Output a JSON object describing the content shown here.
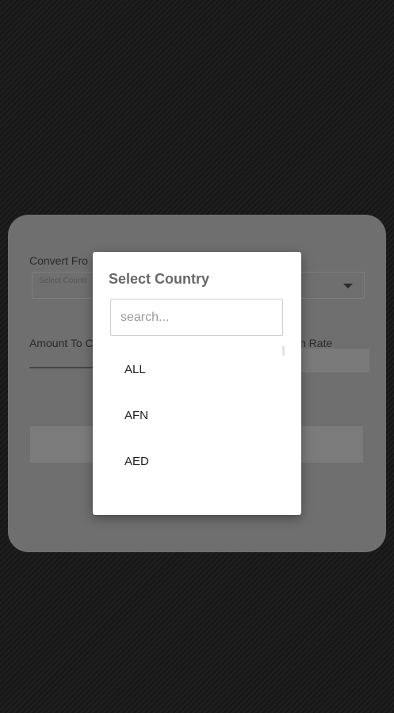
{
  "converter": {
    "convert_from_label": "Convert Fro",
    "select_placeholder": "Select Countr",
    "amount_label": "Amount To C",
    "rate_label": "n Rate"
  },
  "dialog": {
    "title": "Select Country",
    "search_placeholder": "search...",
    "items": [
      {
        "label": "ALL"
      },
      {
        "label": "AFN"
      },
      {
        "label": "AED"
      }
    ]
  },
  "colors": {
    "backdrop": "#1c1c1c",
    "card_dimmed": "#6f6f6f",
    "dialog_bg": "#ffffff",
    "title_text": "#676767"
  },
  "icons": {
    "dropdown": "caret-down-icon"
  }
}
